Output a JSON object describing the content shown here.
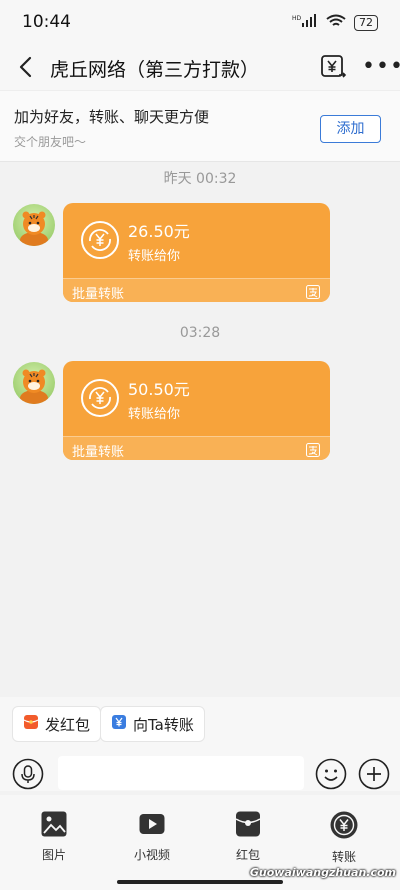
{
  "status": {
    "time": "10:44",
    "signal": "HD",
    "battery": "72"
  },
  "header": {
    "title": "虎丘网络（第三方打款）"
  },
  "friend_bar": {
    "main": "加为好友，转账、聊天更方便",
    "sub": "交个朋友吧～",
    "add_label": "添加"
  },
  "messages": [
    {
      "timestamp": "昨天 00:32",
      "amount": "26.50元",
      "desc": "转账给你",
      "footer": "批量转账"
    },
    {
      "timestamp": "03:28",
      "amount": "50.50元",
      "desc": "转账给你",
      "footer": "批量转账"
    }
  ],
  "quick_actions": [
    {
      "label": "发红包",
      "icon": "red-packet-icon"
    },
    {
      "label": "向Ta转账",
      "icon": "transfer-icon"
    }
  ],
  "toolbar": [
    {
      "label": "图片",
      "icon": "image-icon"
    },
    {
      "label": "小视频",
      "icon": "video-icon"
    },
    {
      "label": "红包",
      "icon": "red-packet-icon"
    },
    {
      "label": "转账",
      "icon": "yuan-icon"
    }
  ],
  "watermark": "Guowaiwangzhuan.com",
  "colors": {
    "card": "#f7a33b",
    "card_footer": "#f9b155",
    "accent_blue": "#2f6ecf",
    "red_packet": "#f25b2b",
    "transfer_blue": "#3a7de0"
  }
}
